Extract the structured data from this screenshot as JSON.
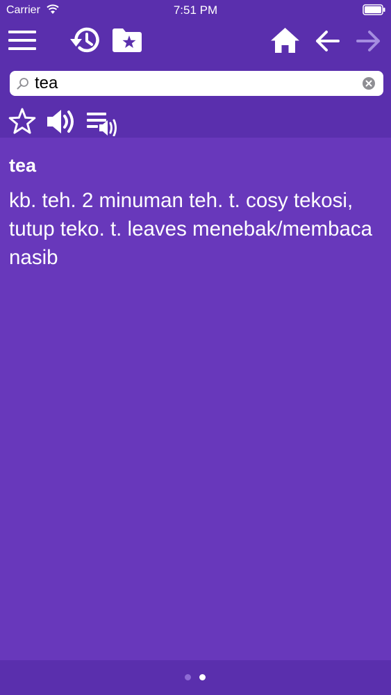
{
  "status_bar": {
    "carrier": "Carrier",
    "time": "7:51 PM"
  },
  "toolbar": {
    "icons": [
      "menu-icon",
      "history-icon",
      "favorites-folder-icon",
      "home-icon",
      "back-arrow-icon",
      "forward-arrow-icon"
    ],
    "forward_enabled": false
  },
  "search": {
    "value": "tea",
    "placeholder": ""
  },
  "actions": {
    "icons": [
      "star-icon",
      "speaker-icon",
      "speak-list-icon"
    ]
  },
  "entry": {
    "word": "tea",
    "definition": "kb. teh. 2 minuman teh. t. cosy tekosi,\ntutup teko. t. leaves menebak/membaca\nnasib"
  },
  "pager": {
    "total": 2,
    "current": 2
  },
  "colors": {
    "header_bg": "#5a2fad",
    "content_bg": "#6838bb",
    "icon": "#ffffff",
    "icon_disabled": "#a58de0",
    "dot_active": "#ffffff",
    "dot_inactive": "#8e6bd4"
  }
}
